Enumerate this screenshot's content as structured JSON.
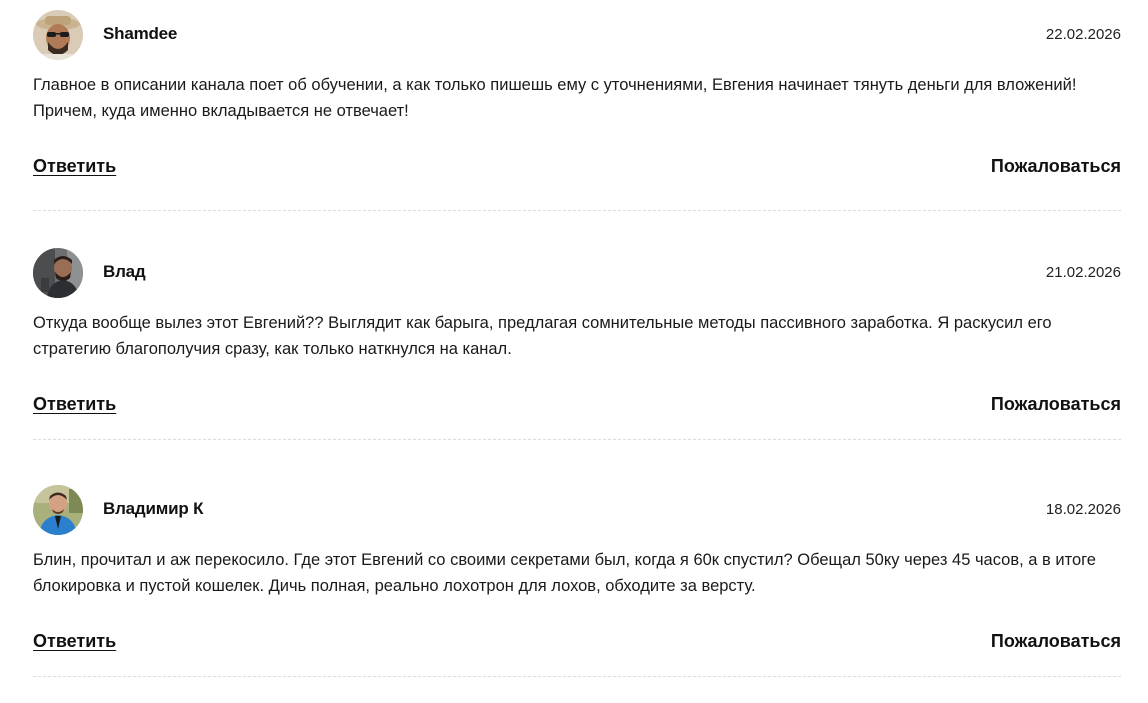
{
  "comments": [
    {
      "author": "Shamdee",
      "date": "22.02.2026",
      "text": "Главное в описании канала поет об обучении, а как только пишешь ему с уточнениями, Евгения начинает тянуть деньги для вложений! Причем, куда именно вкладывается не отвечает!",
      "reply_label": "Ответить",
      "report_label": "Пожаловаться"
    },
    {
      "author": "Влад",
      "date": "21.02.2026",
      "text": "Откуда вообще вылез этот Евгений?? Выглядит как барыга, предлагая сомнительные методы пассивного заработка. Я раскусил его стратегию благополучия сразу, как только наткнулся на канал.",
      "reply_label": "Ответить",
      "report_label": "Пожаловаться"
    },
    {
      "author": "Владимир К",
      "date": "18.02.2026",
      "text": "Блин, прочитал и аж перекосило. Где этот Евгений со своими секретами был, когда я 60к спустил? Обещал 50ку через 45 часов, а в итоге блокировка и пустой кошелек. Дичь полная, реально лохотрон для лохов, обходите за версту.",
      "reply_label": "Ответить",
      "report_label": "Пожаловаться"
    }
  ]
}
